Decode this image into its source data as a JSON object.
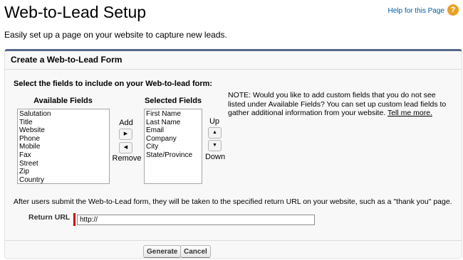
{
  "header": {
    "title": "Web-to-Lead Setup",
    "help_link": "Help for this Page",
    "help_icon_glyph": "?",
    "description": "Easily set up a page on your website to capture new leads."
  },
  "panel": {
    "title": "Create a Web-to-Lead Form",
    "instructions": "Select the fields to include on your Web-to-lead form:"
  },
  "available": {
    "label": "Available Fields",
    "items": [
      "Salutation",
      "Title",
      "Website",
      "Phone",
      "Mobile",
      "Fax",
      "Street",
      "Zip",
      "Country"
    ]
  },
  "selected": {
    "label": "Selected Fields",
    "items": [
      "First Name",
      "Last Name",
      "Email",
      "Company",
      "City",
      "State/Province"
    ]
  },
  "controls": {
    "add": "Add",
    "remove": "Remove",
    "up": "Up",
    "down": "Down",
    "add_arrow": "▶",
    "remove_arrow": "◀",
    "up_arrow": "▲",
    "down_arrow": "▼"
  },
  "note": {
    "text": "NOTE: Would you like to add custom fields that you do not see listed under Available Fields? You can set up custom lead fields to gather additional information from your website. ",
    "link": "Tell me more."
  },
  "return_url": {
    "description": "After users submit the Web-to-Lead form, they will be taken to the specified return URL on your website, such as a \"thank you\" page.",
    "label": "Return URL",
    "value": "http://"
  },
  "buttons": {
    "generate": "Generate",
    "cancel": "Cancel"
  },
  "colors": {
    "panel_border_top": "#56688b",
    "link": "#015ba7",
    "help_icon": "#e8a126",
    "required": "#cc0000"
  },
  "icons": {
    "help": "help-icon"
  }
}
